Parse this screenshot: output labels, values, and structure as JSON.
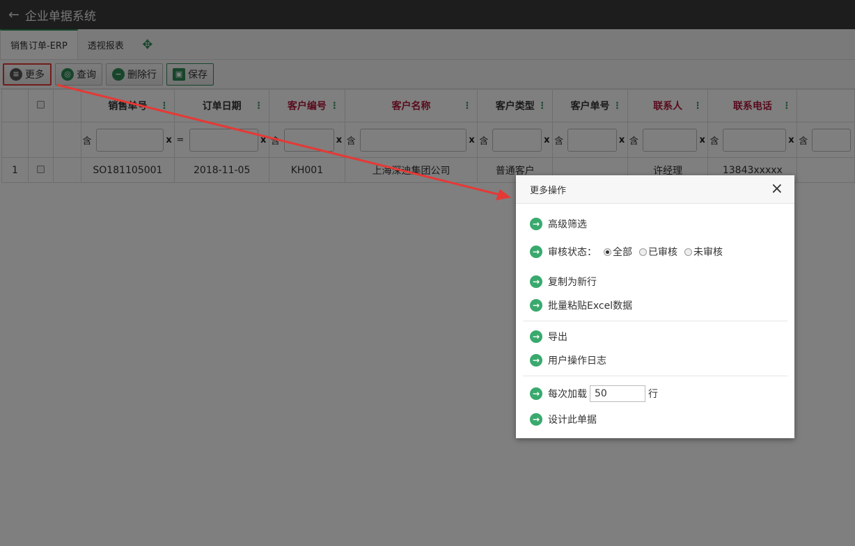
{
  "header": {
    "back_icon": "arrow-left-icon",
    "title": "企业单据系统"
  },
  "tabs": [
    {
      "label": "销售订单-ERP",
      "active": true
    },
    {
      "label": "透视报表",
      "active": false
    }
  ],
  "toolbar": {
    "more_label": "更多",
    "query_label": "查询",
    "delete_row_label": "删除行",
    "save_label": "保存"
  },
  "grid": {
    "columns": [
      {
        "label": "销售单号",
        "required": false,
        "op": "含"
      },
      {
        "label": "订单日期",
        "required": false,
        "op": "="
      },
      {
        "label": "客户编号",
        "required": true,
        "op": "含"
      },
      {
        "label": "客户名称",
        "required": true,
        "op": "含"
      },
      {
        "label": "客户类型",
        "required": false,
        "op": "含"
      },
      {
        "label": "客户单号",
        "required": false,
        "op": "含"
      },
      {
        "label": "联系人",
        "required": true,
        "op": "含"
      },
      {
        "label": "联系电话",
        "required": true,
        "op": "含"
      },
      {
        "label": "",
        "required": false,
        "op": "含"
      }
    ],
    "clear_label": "x",
    "rows": [
      {
        "num": "1",
        "cells": [
          "SO181105001",
          "2018-11-05",
          "KH001",
          "上海深迪集团公司",
          "普通客户",
          "",
          "许经理",
          "13843xxxxx",
          ""
        ]
      }
    ]
  },
  "modal": {
    "title": "更多操作",
    "close": "×",
    "advanced_filter": "高级筛选",
    "audit_label": "审核状态：",
    "audit_options": [
      "全部",
      "已审核",
      "未审核"
    ],
    "audit_selected": "全部",
    "copy_row": "复制为新行",
    "paste_excel": "批量粘贴Excel数据",
    "export": "导出",
    "user_log": "用户操作日志",
    "load_prefix": "每次加载",
    "load_value": "50",
    "load_suffix": "行",
    "design": "设计此单据"
  },
  "colors": {
    "accent": "#2e8b57",
    "required_header": "#b0183a",
    "highlight": "#e53935"
  }
}
